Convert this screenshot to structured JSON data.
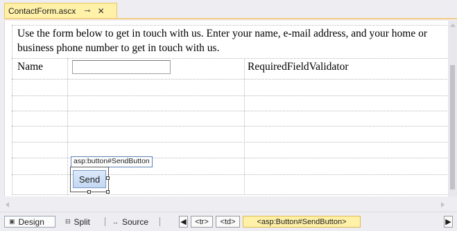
{
  "tab": {
    "title": "ContactForm.ascx",
    "pin_glyph": "⊸",
    "close_glyph": "✕"
  },
  "form": {
    "intro_text": "Use the form below to get in touch with us. Enter your name, e-mail address, and your home or business phone number to get in touch with us.",
    "name_label": "Name",
    "name_value": "",
    "validator_label": "RequiredFieldValidator",
    "control_tag": "asp:button#SendButton",
    "send_label": "Send"
  },
  "bottom": {
    "design_label": "Design",
    "split_label": "Split",
    "source_label": "Source",
    "crumbs": [
      "<tr>",
      "<td>",
      "<asp:Button#SendButton>"
    ],
    "prev_glyph": "◀",
    "next_glyph": "▶"
  },
  "colors": {
    "active_tab": "#fff1a8",
    "selection_border": "#5b7fb5",
    "button_fill": "#c3d8f2"
  }
}
